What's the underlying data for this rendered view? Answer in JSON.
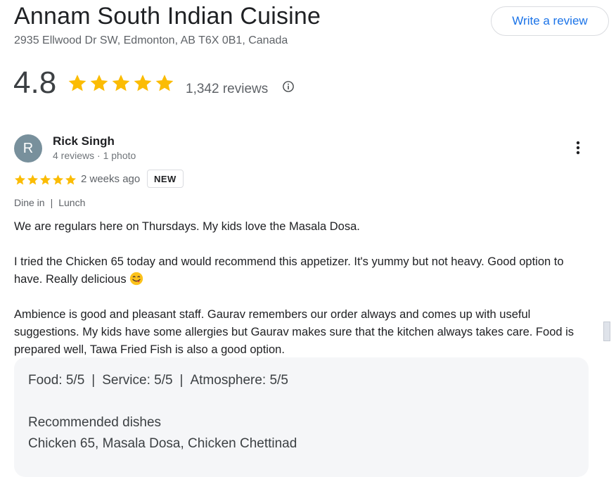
{
  "place": {
    "name": "Annam South Indian Cuisine",
    "address": "2935 Ellwood Dr SW, Edmonton, AB T6X 0B1, Canada",
    "rating": "4.8",
    "stars": 5,
    "review_count": "1,342 reviews"
  },
  "actions": {
    "write_review_label": "Write a review"
  },
  "review": {
    "avatar_letter": "R",
    "reviewer_name": "Rick Singh",
    "reviewer_meta": "4 reviews · 1 photo",
    "stars": 5,
    "date": "2 weeks ago",
    "badge": "NEW",
    "tags": [
      "Dine in",
      "Lunch"
    ],
    "paragraphs": [
      "We are regulars here on Thursdays. My kids love the Masala Dosa.",
      "I tried the Chicken 65 today and would recommend this appetizer. It's yummy but not heavy. Good option to have. Really delicious",
      "Ambience is good and pleasant staff. Gaurav remembers our order always and comes up with useful suggestions. My kids have some allergies but Gaurav makes sure that the kitchen always takes care. Food is prepared well, Tawa Fried Fish is also a good option."
    ],
    "scores": {
      "food": "Food: 5/5",
      "service": "Service: 5/5",
      "atmosphere": "Atmosphere: 5/5"
    },
    "recommended_label": "Recommended dishes",
    "recommended_dishes": "Chicken 65, Masala Dosa, Chicken Chettinad"
  },
  "icons": {
    "star": "star-icon",
    "info": "info-icon",
    "more": "more-vert-icon",
    "emoji": "yum-face-emoji-icon"
  },
  "colors": {
    "star": "#fbbc04",
    "accent_blue": "#1a73e8",
    "avatar_bg": "#78909c",
    "summary_bg": "#f5f6f8"
  }
}
